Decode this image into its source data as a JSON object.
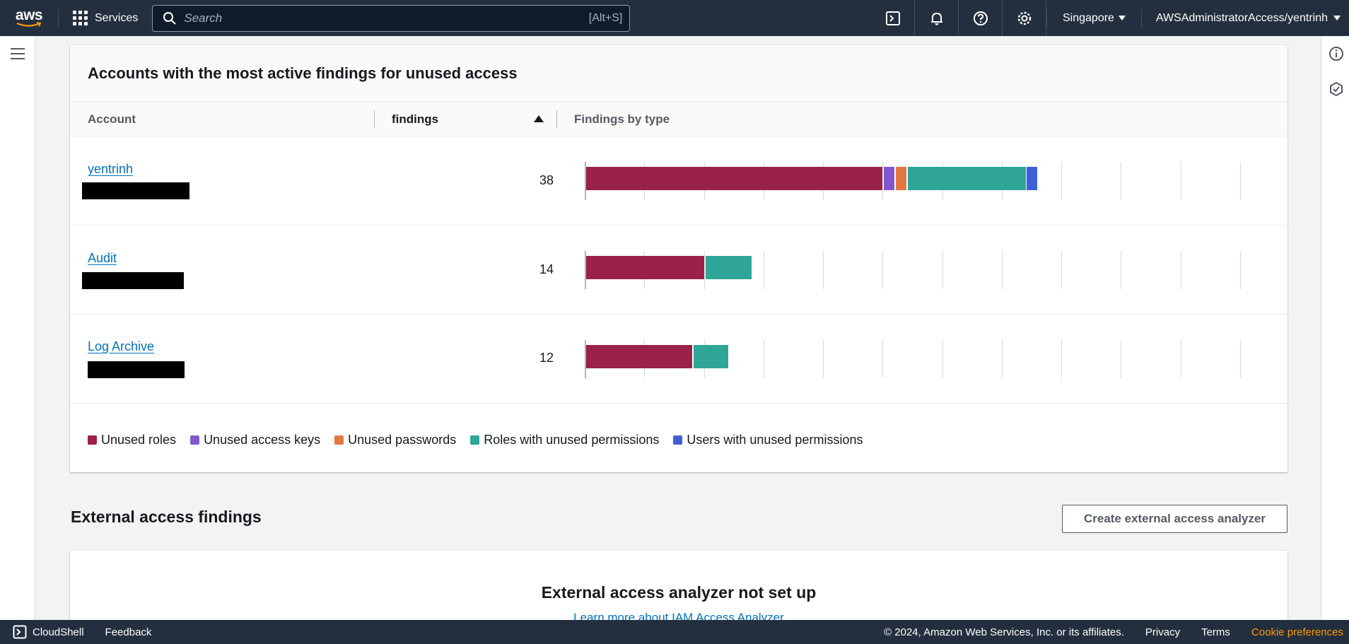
{
  "topnav": {
    "logo_text": "aws",
    "services_label": "Services",
    "search_placeholder": "Search",
    "search_shortcut": "[Alt+S]",
    "region": "Singapore",
    "account": "AWSAdministratorAccess/yentrinh",
    "icons": [
      "cloudshell-icon",
      "bell-icon",
      "help-icon",
      "settings-icon"
    ]
  },
  "unused_access": {
    "title": "Accounts with the most active findings for unused access",
    "columns": [
      "Account",
      "findings",
      "Findings by type"
    ],
    "sort": {
      "column": "findings",
      "direction": "ascending"
    },
    "rows": [
      {
        "account": "yentrinh",
        "findings": "38"
      },
      {
        "account": "Audit",
        "findings": "14"
      },
      {
        "account": "Log Archive",
        "findings": "12"
      }
    ],
    "legend": [
      {
        "label": "Unused roles",
        "color": "#99214a"
      },
      {
        "label": "Unused access keys",
        "color": "#8456ce"
      },
      {
        "label": "Unused passwords",
        "color": "#e07941"
      },
      {
        "label": "Roles with unused permissions",
        "color": "#2ea597"
      },
      {
        "label": "Users with unused permissions",
        "color": "#3f5fd8"
      }
    ]
  },
  "chart_data": {
    "type": "bar",
    "orientation": "horizontal",
    "stacked": true,
    "categories": [
      "yentrinh",
      "Audit",
      "Log Archive"
    ],
    "series": [
      {
        "name": "Unused roles",
        "values": [
          25,
          10,
          9
        ]
      },
      {
        "name": "Unused access keys",
        "values": [
          1,
          0,
          0
        ]
      },
      {
        "name": "Unused passwords",
        "values": [
          1,
          0,
          0
        ]
      },
      {
        "name": "Roles with unused permissions",
        "values": [
          10,
          4,
          3
        ]
      },
      {
        "name": "Users with unused permissions",
        "values": [
          1,
          0,
          0
        ]
      }
    ],
    "xlim": [
      0,
      57
    ],
    "grid": true,
    "legend": "bottom"
  },
  "external_access": {
    "title": "External access findings",
    "create_button": "Create external access analyzer",
    "empty_title": "External access analyzer not set up",
    "empty_link": "Learn more about IAM Access Analyzer"
  },
  "footer": {
    "cloudshell": "CloudShell",
    "feedback": "Feedback",
    "copyright": "© 2024, Amazon Web Services, Inc. or its affiliates.",
    "privacy": "Privacy",
    "terms": "Terms",
    "cookie": "Cookie preferences"
  }
}
